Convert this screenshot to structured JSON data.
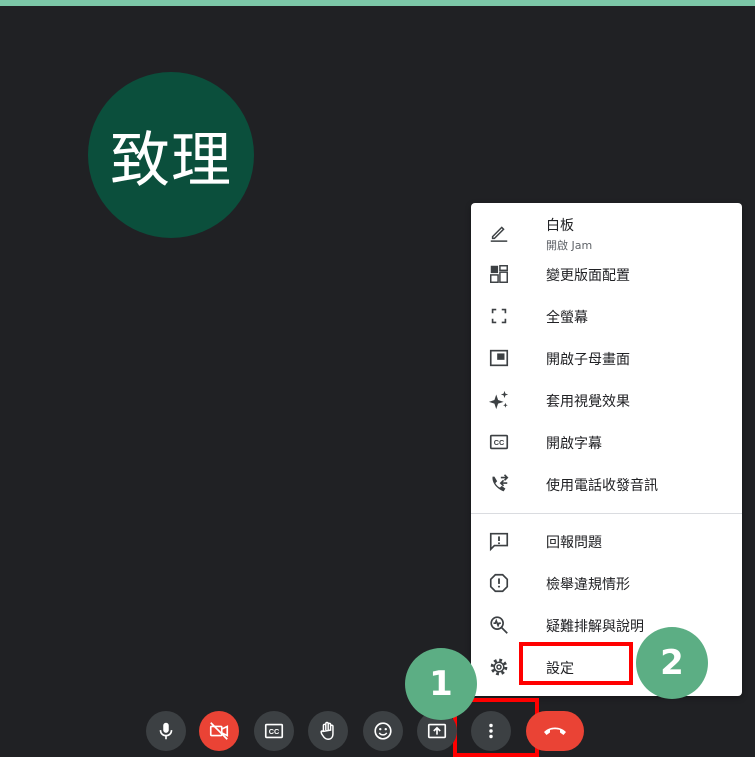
{
  "avatar": {
    "name": "致理"
  },
  "menu": {
    "items": [
      {
        "label": "白板",
        "sub": "開啟 Jam",
        "icon": "pencil-icon"
      },
      {
        "label": "變更版面配置",
        "icon": "layout-icon"
      },
      {
        "label": "全螢幕",
        "icon": "fullscreen-icon"
      },
      {
        "label": "開啟子母畫面",
        "icon": "picture-in-picture-icon"
      },
      {
        "label": "套用視覺效果",
        "icon": "sparkle-icon"
      },
      {
        "label": "開啟字幕",
        "icon": "closed-caption-icon"
      },
      {
        "label": "使用電話收發音訊",
        "icon": "phone-forward-icon"
      },
      {
        "label": "回報問題",
        "icon": "feedback-icon"
      },
      {
        "label": "檢舉違規情形",
        "icon": "report-icon"
      },
      {
        "label": "疑難排解與說明",
        "icon": "troubleshoot-icon"
      },
      {
        "label": "設定",
        "icon": "gear-icon"
      }
    ]
  },
  "annotations": {
    "step1": "1",
    "step2": "2"
  },
  "controls": [
    "microphone-icon",
    "camera-off-icon",
    "captions-icon",
    "raise-hand-icon",
    "emoji-icon",
    "present-icon",
    "more-options-icon",
    "hang-up-icon"
  ],
  "colors": {
    "background": "#202124",
    "accent": "#7cc7a7",
    "avatar": "#0b4f3c",
    "danger": "#ea4335",
    "highlight": "#ff0000",
    "step": "#5cae84"
  }
}
